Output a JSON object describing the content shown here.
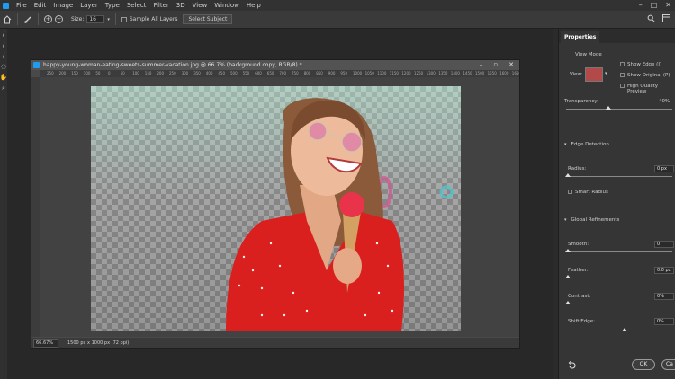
{
  "menu": [
    "File",
    "Edit",
    "Image",
    "Layer",
    "Type",
    "Select",
    "Filter",
    "3D",
    "View",
    "Window",
    "Help"
  ],
  "options": {
    "size_label": "Size:",
    "size_value": "16",
    "sample_all_layers": "Sample All Layers",
    "select_subject": "Select Subject"
  },
  "document": {
    "title": "happy-young-woman-eating-sweets-summer-vacation.jpg @ 66.7% (background copy, RGB/8) *",
    "zoom": "66.67%",
    "info": "1500 px x 1000 px (72 ppi)",
    "ruler_ticks": [
      "250",
      "200",
      "150",
      "100",
      "50",
      "0",
      "50",
      "100",
      "150",
      "200",
      "250",
      "300",
      "350",
      "400",
      "450",
      "500",
      "550",
      "600",
      "650",
      "700",
      "750",
      "800",
      "850",
      "900",
      "950",
      "1000",
      "1050",
      "1100",
      "1150",
      "1200",
      "1250",
      "1300",
      "1350",
      "1400",
      "1450",
      "1500",
      "1550",
      "1600",
      "1650"
    ]
  },
  "properties": {
    "tab": "Properties",
    "view_mode": "View Mode",
    "view_label": "View:",
    "show_edge": "Show Edge (J)",
    "show_original": "Show Original (P)",
    "high_quality": "High Quality Preview",
    "transparency_label": "Transparency:",
    "transparency_value": "40%",
    "transparency_level": 0.4,
    "edge_detection": "Edge Detection",
    "radius_label": "Radius:",
    "radius_value": "0 px",
    "smart_radius": "Smart Radius",
    "global_refinements": "Global Refinements",
    "smooth_label": "Smooth:",
    "smooth_value": "0",
    "feather_label": "Feather:",
    "feather_value": "0.0 px",
    "contrast_label": "Contrast:",
    "contrast_value": "0%",
    "shift_edge_label": "Shift Edge:",
    "shift_edge_value": "0%",
    "ok": "OK",
    "cancel": "Ca"
  }
}
